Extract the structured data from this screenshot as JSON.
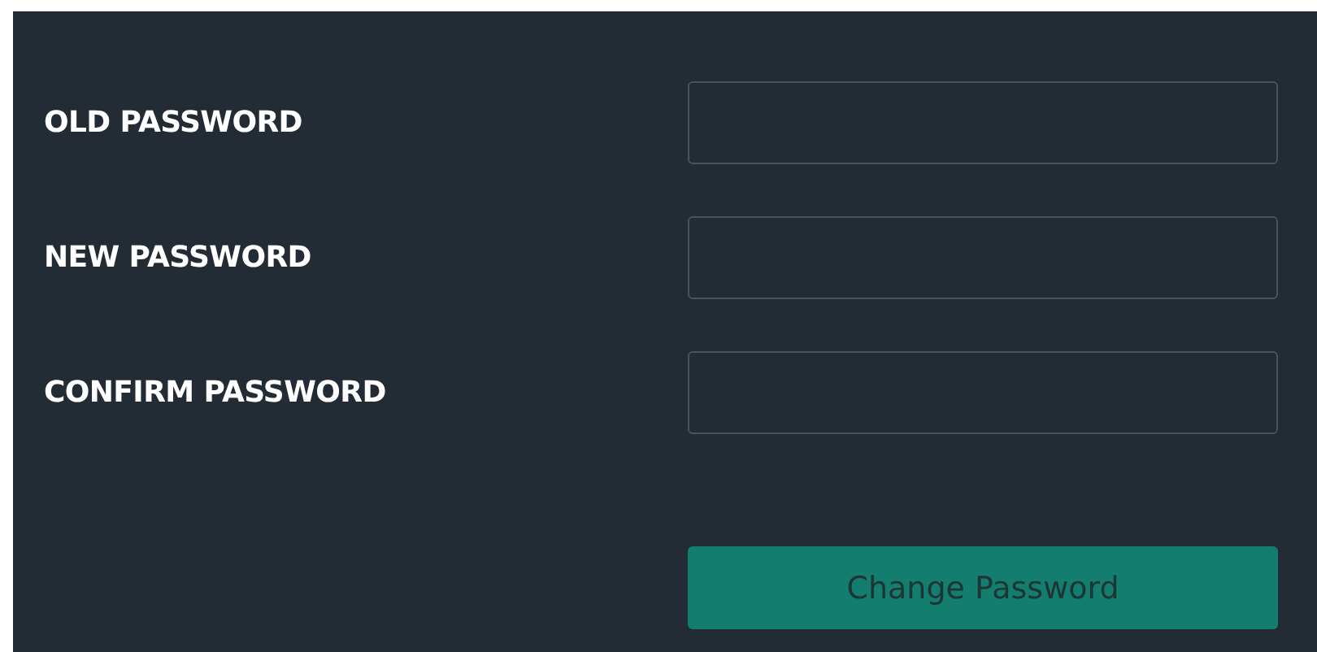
{
  "fields": [
    {
      "label": "OLD PASSWORD"
    },
    {
      "label": "NEW PASSWORD"
    },
    {
      "label": "CONFIRM PASSWORD"
    }
  ],
  "button": {
    "label": "Change Password"
  }
}
